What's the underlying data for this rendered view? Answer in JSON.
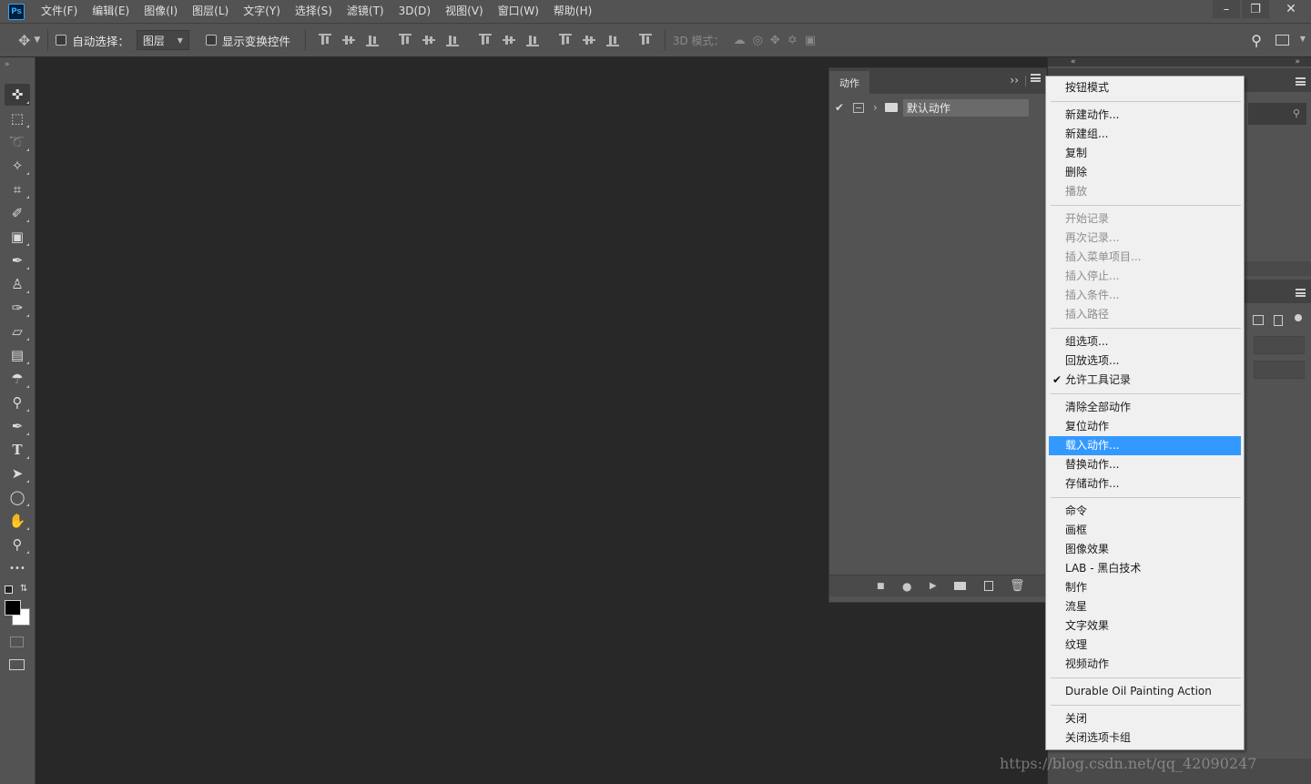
{
  "app": {
    "logo": "Ps"
  },
  "menubar": {
    "items": [
      "文件(F)",
      "编辑(E)",
      "图像(I)",
      "图层(L)",
      "文字(Y)",
      "选择(S)",
      "滤镜(T)",
      "3D(D)",
      "视图(V)",
      "窗口(W)",
      "帮助(H)"
    ]
  },
  "window_controls": {
    "minimize": "–",
    "restore": "❐",
    "close": "✕"
  },
  "options": {
    "auto_select_label": "自动选择：",
    "auto_select_checked": false,
    "layer_select_value": "图层",
    "show_transform_label": "显示变换控件",
    "show_transform_checked": false,
    "mode_3d_label": "3D 模式："
  },
  "actions_panel": {
    "tab_label": "动作",
    "collapse_glyph": "››",
    "set_name": "默认动作",
    "set_checked": true
  },
  "context_menu": {
    "groups": [
      [
        {
          "label": "按钮模式",
          "enabled": true
        }
      ],
      [
        {
          "label": "新建动作...",
          "enabled": true
        },
        {
          "label": "新建组...",
          "enabled": true
        },
        {
          "label": "复制",
          "enabled": true
        },
        {
          "label": "删除",
          "enabled": true
        },
        {
          "label": "播放",
          "enabled": false
        }
      ],
      [
        {
          "label": "开始记录",
          "enabled": false
        },
        {
          "label": "再次记录...",
          "enabled": false
        },
        {
          "label": "插入菜单项目...",
          "enabled": false
        },
        {
          "label": "插入停止...",
          "enabled": false
        },
        {
          "label": "插入条件...",
          "enabled": false
        },
        {
          "label": "插入路径",
          "enabled": false
        }
      ],
      [
        {
          "label": "组选项...",
          "enabled": true
        },
        {
          "label": "回放选项...",
          "enabled": true
        },
        {
          "label": "允许工具记录",
          "enabled": true,
          "checked": true
        }
      ],
      [
        {
          "label": "清除全部动作",
          "enabled": true
        },
        {
          "label": "复位动作",
          "enabled": true
        },
        {
          "label": "载入动作...",
          "enabled": true,
          "highlighted": true
        },
        {
          "label": "替换动作...",
          "enabled": true
        },
        {
          "label": "存储动作...",
          "enabled": true
        }
      ],
      [
        {
          "label": "命令",
          "enabled": true
        },
        {
          "label": "画框",
          "enabled": true
        },
        {
          "label": "图像效果",
          "enabled": true
        },
        {
          "label": "LAB - 黑白技术",
          "enabled": true
        },
        {
          "label": "制作",
          "enabled": true
        },
        {
          "label": "流星",
          "enabled": true
        },
        {
          "label": "文字效果",
          "enabled": true
        },
        {
          "label": "纹理",
          "enabled": true
        },
        {
          "label": "视频动作",
          "enabled": true
        }
      ],
      [
        {
          "label": "Durable Oil Painting Action",
          "enabled": true
        }
      ],
      [
        {
          "label": "关闭",
          "enabled": true
        },
        {
          "label": "关闭选项卡组",
          "enabled": true
        }
      ]
    ]
  },
  "watermark": "https://blog.csdn.net/qq_42090247",
  "colors": {
    "highlight": "#3399ff",
    "panel": "#535353",
    "workspace": "#282828"
  }
}
